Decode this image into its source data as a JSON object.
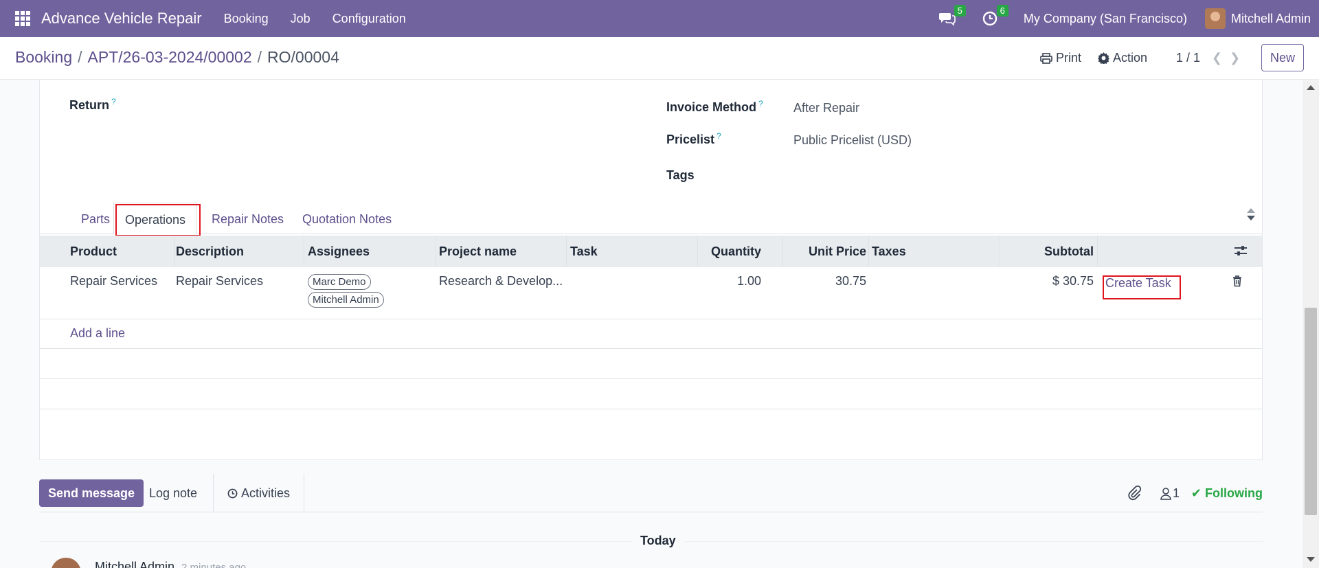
{
  "navbar": {
    "app_name": "Advance Vehicle Repair",
    "menus": [
      "Booking",
      "Job",
      "Configuration"
    ],
    "messages_count": "5",
    "activities_count": "6",
    "company": "My Company (San Francisco)",
    "user": "Mitchell Admin"
  },
  "breadcrumb": {
    "root": "Booking",
    "parent": "APT/26-03-2024/00002",
    "current": "RO/00004",
    "separator": "/"
  },
  "control": {
    "print": "Print",
    "action": "Action",
    "pager": "1 / 1",
    "new": "New"
  },
  "form": {
    "return_label": "Return",
    "invoice_method_label": "Invoice Method",
    "invoice_method_value": "After Repair",
    "pricelist_label": "Pricelist",
    "pricelist_value": "Public Pricelist (USD)",
    "tags_label": "Tags",
    "help_mark": "?"
  },
  "tabs": [
    "Parts",
    "Operations",
    "Repair Notes",
    "Quotation Notes"
  ],
  "table": {
    "headers": {
      "product": "Product",
      "description": "Description",
      "assignees": "Assignees",
      "project": "Project name",
      "task": "Task",
      "quantity": "Quantity",
      "unit_price": "Unit Price",
      "taxes": "Taxes",
      "subtotal": "Subtotal"
    },
    "rows": [
      {
        "product": "Repair Services",
        "description": "Repair Services",
        "assignees": [
          "Marc Demo",
          "Mitchell Admin"
        ],
        "project": "Research & Develop...",
        "task": "",
        "quantity": "1.00",
        "unit_price": "30.75",
        "taxes": "",
        "subtotal": "$ 30.75",
        "action": "Create Task"
      }
    ],
    "add_line": "Add a line"
  },
  "chatter": {
    "send_message": "Send message",
    "log_note": "Log note",
    "activities": "Activities",
    "followers_count": "1",
    "following": "Following",
    "today": "Today",
    "message_author": "Mitchell Admin",
    "message_time": "2 minutes ago"
  },
  "colors": {
    "brand": "#71639e",
    "link": "#5d4f8c",
    "highlight": "#e0141e",
    "success": "#28a745"
  }
}
